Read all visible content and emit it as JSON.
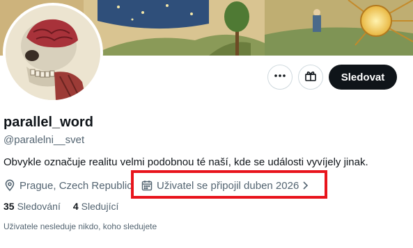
{
  "profile": {
    "display_name": "parallel_word",
    "handle": "@paralelni__svet",
    "bio": "Obvykle označuje realitu velmi podobnou té naší, kde se události vyvíjely jinak.",
    "location": "Prague, Czech Republic",
    "joined": "Uživatel se připojil duben 2026"
  },
  "actions": {
    "follow_label": "Sledovat",
    "more_icon": "more-horizontal-icon",
    "gift_icon": "gift-icon"
  },
  "stats": {
    "following_count": "35",
    "following_label": "Sledování",
    "followers_count": "4",
    "followers_label": "Sledující"
  },
  "followers_note": "Uživatele nesleduje nikdo, koho sledujete",
  "icons": {
    "location": "location-pin-icon",
    "calendar": "calendar-icon",
    "chevron": "chevron-right-icon"
  },
  "colors": {
    "text_primary": "#0f1419",
    "text_secondary": "#536471",
    "follow_button": "#0f1419",
    "highlight_box": "#e8141c"
  }
}
